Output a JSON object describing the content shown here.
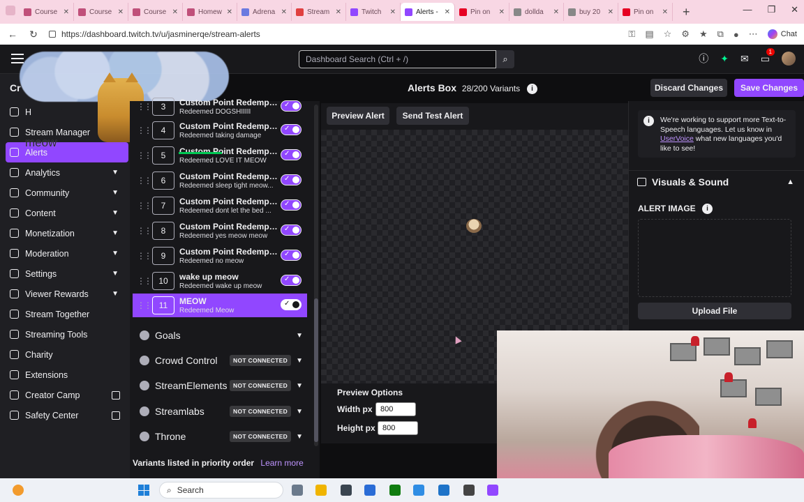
{
  "browser": {
    "tabs": [
      {
        "label": "Course",
        "color": "#c0507a"
      },
      {
        "label": "Course",
        "color": "#c0507a"
      },
      {
        "label": "Course",
        "color": "#c0507a"
      },
      {
        "label": "Homew",
        "color": "#c0507a"
      },
      {
        "label": "Adrena",
        "color": "#6b7ae0"
      },
      {
        "label": "Stream",
        "color": "#e04040"
      },
      {
        "label": "Twitch",
        "color": "#9147ff"
      },
      {
        "label": "Alerts -",
        "color": "#9147ff",
        "active": true
      },
      {
        "label": "Pin on",
        "color": "#e60023"
      },
      {
        "label": "dollda",
        "color": "#888888"
      },
      {
        "label": "buy 20",
        "color": "#888888"
      },
      {
        "label": "Pin on",
        "color": "#e60023"
      }
    ],
    "url": "https://dashboard.twitch.tv/u/jasminerqe/stream-alerts",
    "chat_label": "Chat"
  },
  "topbar": {
    "search_placeholder": "Dashboard Search (Ctrl + /)",
    "notif_count": "1"
  },
  "leftnav": {
    "header": "Cr",
    "items": [
      {
        "label": "H",
        "chevron": false,
        "external": false
      },
      {
        "label": "Stream Manager",
        "chevron": false,
        "external": false
      },
      {
        "label": "Alerts",
        "chevron": false,
        "external": false,
        "active": true
      },
      {
        "label": "Analytics",
        "chevron": true,
        "external": false
      },
      {
        "label": "Community",
        "chevron": true,
        "external": false
      },
      {
        "label": "Content",
        "chevron": true,
        "external": false
      },
      {
        "label": "Monetization",
        "chevron": true,
        "external": false
      },
      {
        "label": "Moderation",
        "chevron": true,
        "external": false
      },
      {
        "label": "Settings",
        "chevron": true,
        "external": false
      },
      {
        "label": "Viewer Rewards",
        "chevron": true,
        "external": false
      },
      {
        "label": "Stream Together",
        "chevron": false,
        "external": false
      },
      {
        "label": "Streaming Tools",
        "chevron": false,
        "external": false
      },
      {
        "label": "Charity",
        "chevron": false,
        "external": false
      },
      {
        "label": "Extensions",
        "chevron": false,
        "external": false
      },
      {
        "label": "Creator Camp",
        "chevron": false,
        "external": true
      },
      {
        "label": "Safety Center",
        "chevron": false,
        "external": true
      }
    ],
    "overlay_text": "meow"
  },
  "header": {
    "title": "Alerts Box",
    "variant_count": "28/200 Variants",
    "discard_label": "Discard Changes",
    "save_label": "Save Changes"
  },
  "variants": [
    {
      "num": "3",
      "title": "Custom Point Redempti...",
      "subtitle": "Redeemed DOGSHIIIII",
      "enabled": true
    },
    {
      "num": "4",
      "title": "Custom Point Redempti...",
      "subtitle": "Redeemed taking damage",
      "enabled": true
    },
    {
      "num": "5",
      "title": "Custom Point Redempti...",
      "subtitle": "Redeemed LOVE IT MEOW",
      "enabled": true
    },
    {
      "num": "6",
      "title": "Custom Point Redempti...",
      "subtitle": "Redeemed sleep tight meow...",
      "enabled": true
    },
    {
      "num": "7",
      "title": "Custom Point Redempti...",
      "subtitle": "Redeemed dont let the bed ...",
      "enabled": true
    },
    {
      "num": "8",
      "title": "Custom Point Redempti...",
      "subtitle": "Redeemed yes meow meow",
      "enabled": true
    },
    {
      "num": "9",
      "title": "Custom Point Redempti...",
      "subtitle": "Redeemed no meow",
      "enabled": true
    },
    {
      "num": "10",
      "title": "wake up meow",
      "subtitle": "Redeemed wake up meow",
      "enabled": true
    },
    {
      "num": "11",
      "title": "MEOW",
      "subtitle": "Redeemed Meow",
      "enabled": true,
      "selected": true
    }
  ],
  "integrations": [
    {
      "label": "Goals",
      "status": ""
    },
    {
      "label": "Crowd Control",
      "status": "NOT CONNECTED"
    },
    {
      "label": "StreamElements",
      "status": "NOT CONNECTED"
    },
    {
      "label": "Streamlabs",
      "status": "NOT CONNECTED"
    },
    {
      "label": "Throne",
      "status": "NOT CONNECTED"
    }
  ],
  "footer": {
    "note": "Variants listed in priority order",
    "link": "Learn more"
  },
  "preview": {
    "preview_alert_label": "Preview Alert",
    "send_test_label": "Send Test Alert",
    "options_title": "Preview Options",
    "width_label": "Width px",
    "width_value": "800",
    "height_label": "Height px",
    "height_value": "800"
  },
  "settings": {
    "notice_before": "We're working to support more Text-to-Speech languages. Let us know in ",
    "notice_link": "UserVoice",
    "notice_after": " what new languages you'd like to see!",
    "visuals_title": "Visuals & Sound",
    "alert_image_label": "ALERT IMAGE",
    "upload_label": "Upload File"
  },
  "taskbar": {
    "search_label": "Search"
  }
}
